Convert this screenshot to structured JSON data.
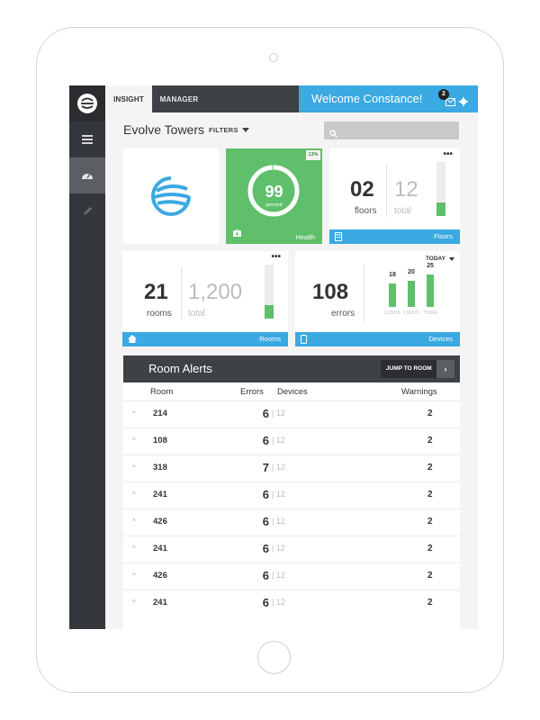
{
  "nav": {
    "tabs": [
      {
        "label": "INSIGHT"
      },
      {
        "label": "MANAGER"
      }
    ],
    "welcome": "Welcome Constance!",
    "notification_count": "2",
    "sidebar_icons": [
      "evolve-logo-icon",
      "menu-icon",
      "dashboard-icon",
      "pencil-icon"
    ]
  },
  "header": {
    "title": "Evolve Towers",
    "filters_label": "FILTERS",
    "search_placeholder": ""
  },
  "health": {
    "value": "99",
    "unit": "percent",
    "badge": "13%",
    "label": "Health",
    "ring_fraction": 0.99
  },
  "floors": {
    "value": "02",
    "value_label": "floors",
    "total": "12",
    "total_label": "total",
    "menu": "•••",
    "footer_label": "Floors",
    "fill_fraction": 0.25
  },
  "rooms": {
    "value": "21",
    "value_label": "rooms",
    "total": "1,200",
    "total_label": "total",
    "menu": "•••",
    "footer_label": "Rooms",
    "fill_fraction": 0.25
  },
  "devices": {
    "value": "108",
    "value_label": "errors",
    "period": "TODAY",
    "footer_label": "Devices",
    "bars": [
      {
        "value": "18",
        "label": "LCM15",
        "fraction": 0.72
      },
      {
        "value": "20",
        "label": "LSM15",
        "fraction": 0.8
      },
      {
        "value": "25",
        "label": "T1000",
        "fraction": 1.0
      }
    ]
  },
  "alerts": {
    "title": "Room Alerts",
    "jump_label": "JUMP TO ROOM",
    "jump_arrow": "›",
    "columns": {
      "room": "Room",
      "errors": "Errors",
      "devices": "Devices",
      "warnings": "Warnings"
    },
    "rows": [
      {
        "room": "214",
        "errors": "6",
        "devices": "| 12",
        "warnings": "2"
      },
      {
        "room": "108",
        "errors": "6",
        "devices": "| 12",
        "warnings": "2"
      },
      {
        "room": "318",
        "errors": "7",
        "devices": "| 12",
        "warnings": "2"
      },
      {
        "room": "241",
        "errors": "6",
        "devices": "| 12",
        "warnings": "2"
      },
      {
        "room": "426",
        "errors": "6",
        "devices": "| 12",
        "warnings": "2"
      },
      {
        "room": "241",
        "errors": "6",
        "devices": "| 12",
        "warnings": "2"
      },
      {
        "room": "426",
        "errors": "6",
        "devices": "| 12",
        "warnings": "2"
      },
      {
        "room": "241",
        "errors": "6",
        "devices": "| 12",
        "warnings": "2"
      }
    ]
  },
  "colors": {
    "accent_blue": "#3ba9e2",
    "health_green": "#5fbf6b",
    "dark": "#3e4146"
  }
}
